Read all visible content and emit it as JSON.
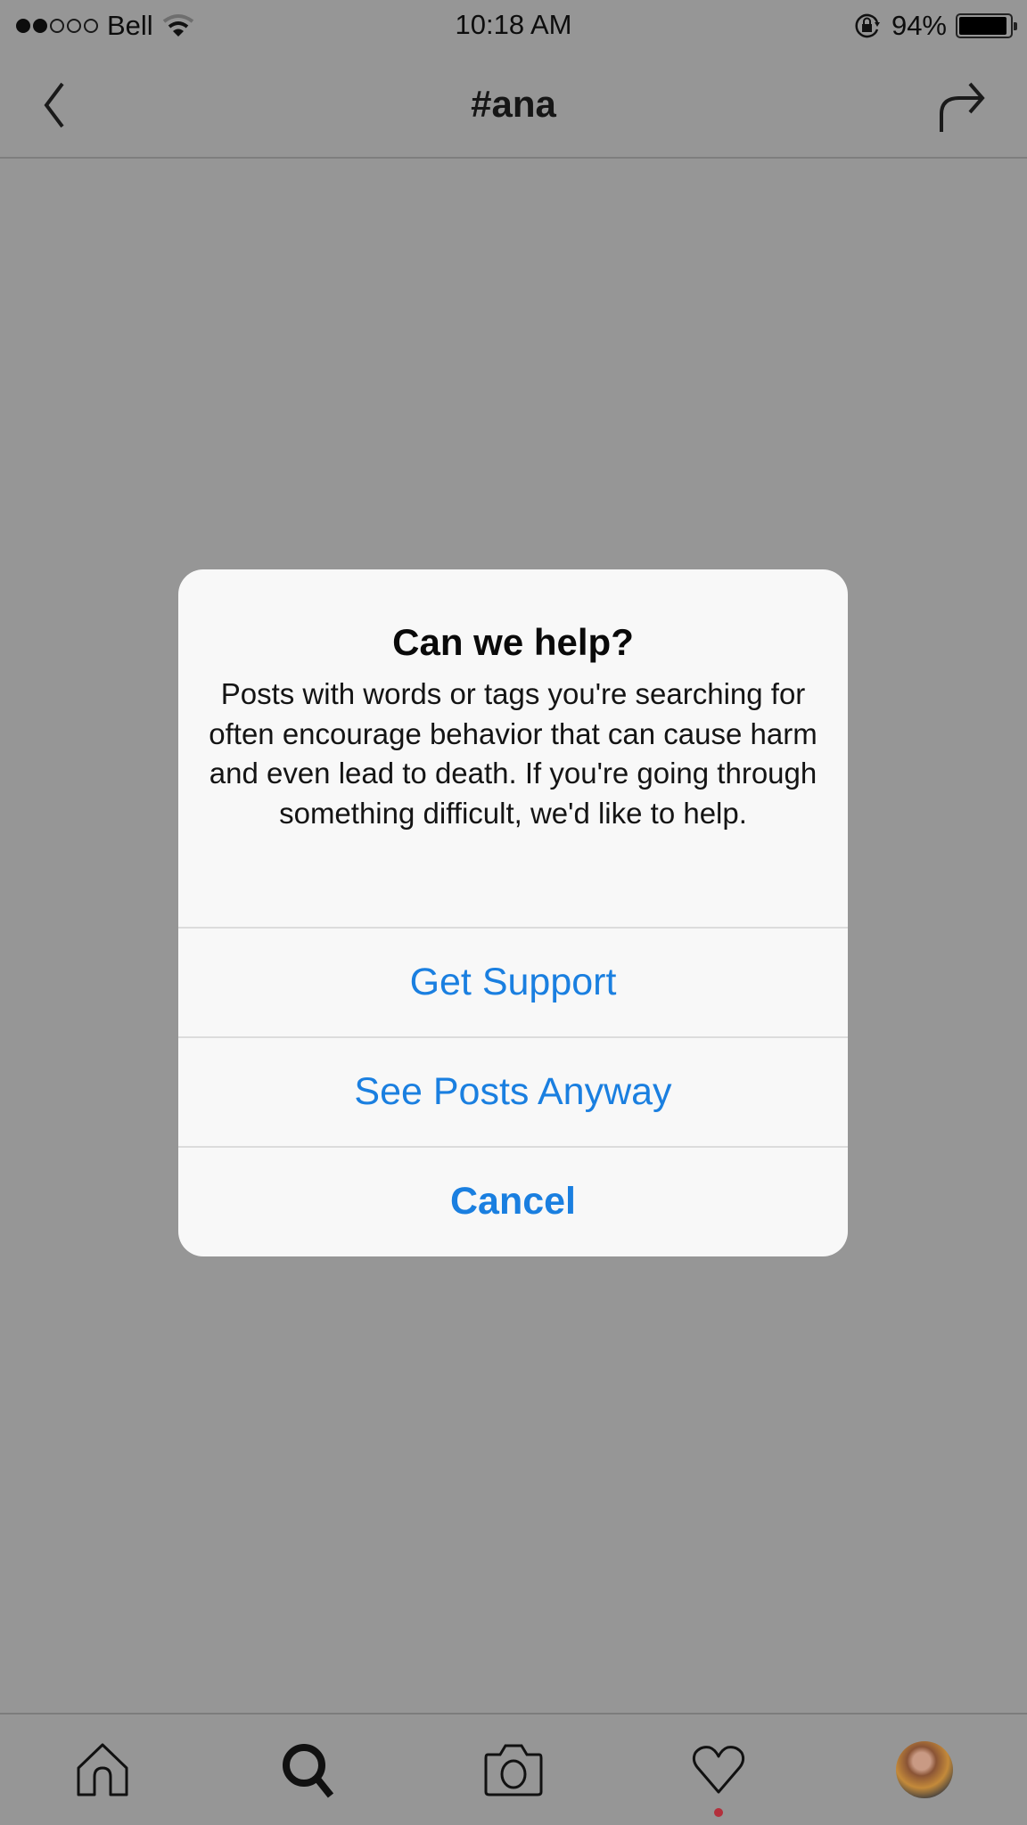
{
  "status_bar": {
    "carrier": "Bell",
    "signal_bars_filled": 2,
    "signal_bars_total": 5,
    "time": "10:18 AM",
    "battery_percent_label": "94%",
    "battery_level": 0.94,
    "icons": [
      "wifi-icon",
      "rotation-lock-icon",
      "battery-icon"
    ]
  },
  "nav_bar": {
    "title": "#ana",
    "back_icon": "chevron-left-icon",
    "share_icon": "share-arrow-icon"
  },
  "dialog": {
    "title": "Can we help?",
    "message": "Posts with words or tags you're searching for often encourage behavior that can cause harm and even lead to death. If you're going through something difficult, we'd like to help.",
    "buttons": [
      {
        "label": "Get Support",
        "style": "default"
      },
      {
        "label": "See Posts Anyway",
        "style": "default"
      },
      {
        "label": "Cancel",
        "style": "bold"
      }
    ],
    "accent_color": "#1a7fe0"
  },
  "tab_bar": {
    "items": [
      {
        "name": "home",
        "icon": "home-icon"
      },
      {
        "name": "search",
        "icon": "search-icon",
        "active": true
      },
      {
        "name": "camera",
        "icon": "camera-icon"
      },
      {
        "name": "activity",
        "icon": "heart-icon",
        "has_notification": true
      },
      {
        "name": "profile",
        "icon": "avatar"
      }
    ],
    "notification_color": "#b3303c"
  }
}
